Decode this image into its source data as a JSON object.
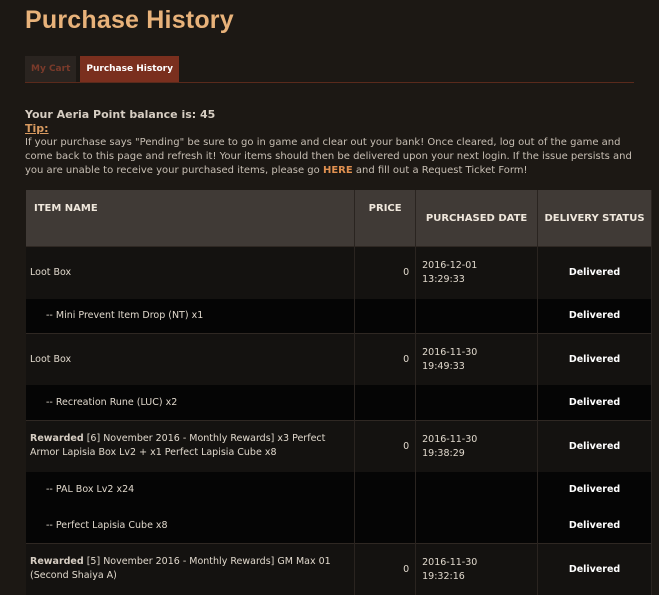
{
  "page": {
    "title": "Purchase History"
  },
  "tabs": [
    {
      "label": "My Cart"
    },
    {
      "label": "Purchase History"
    }
  ],
  "balance": "Your Aeria Point balance is: 45",
  "tip": {
    "label": "Tip:",
    "text_before": "If your purchase says \"Pending\" be sure to go in game and clear out your bank! Once cleared, log out of the game and come back to this page and refresh it! Your items should then be delivered upon your next login. If the issue persists and you are unable to receive your purchased items, please go ",
    "link": "HERE",
    "text_after": " and fill out a Request Ticket Form!"
  },
  "table": {
    "headers": {
      "name": "ITEM NAME",
      "price": "PRICE",
      "date": "PURCHASED DATE",
      "status": "DELIVERY STATUS"
    },
    "rows": [
      {
        "type": "item",
        "prefix": "",
        "name": "Loot Box",
        "price": "0",
        "date": "2016-12-01",
        "time": "13:29:33",
        "status": "Delivered"
      },
      {
        "type": "sub",
        "name": "-- Mini Prevent Item Drop (NT) x1",
        "status": "Delivered"
      },
      {
        "type": "item",
        "prefix": "",
        "name": "Loot Box",
        "price": "0",
        "date": "2016-11-30",
        "time": "19:49:33",
        "status": "Delivered"
      },
      {
        "type": "sub",
        "name": "-- Recreation Rune (LUC) x2",
        "status": "Delivered"
      },
      {
        "type": "item",
        "prefix": "Rewarded",
        "name": "[6] November 2016 - Monthly Rewards] x3 Perfect Armor Lapisia Box Lv2 + x1 Perfect Lapisia Cube x8",
        "price": "0",
        "date": "2016-11-30",
        "time": "19:38:29",
        "status": "Delivered"
      },
      {
        "type": "sub",
        "name": "-- PAL Box Lv2 x24",
        "status": "Delivered"
      },
      {
        "type": "sub",
        "name": "-- Perfect Lapisia Cube x8",
        "status": "Delivered"
      },
      {
        "type": "item",
        "prefix": "Rewarded",
        "name": "[5] November 2016 - Monthly Rewards] GM Max 01 (Second Shaiya A)",
        "price": "0",
        "date": "2016-11-30",
        "time": "19:32:16",
        "status": "Delivered"
      }
    ]
  }
}
